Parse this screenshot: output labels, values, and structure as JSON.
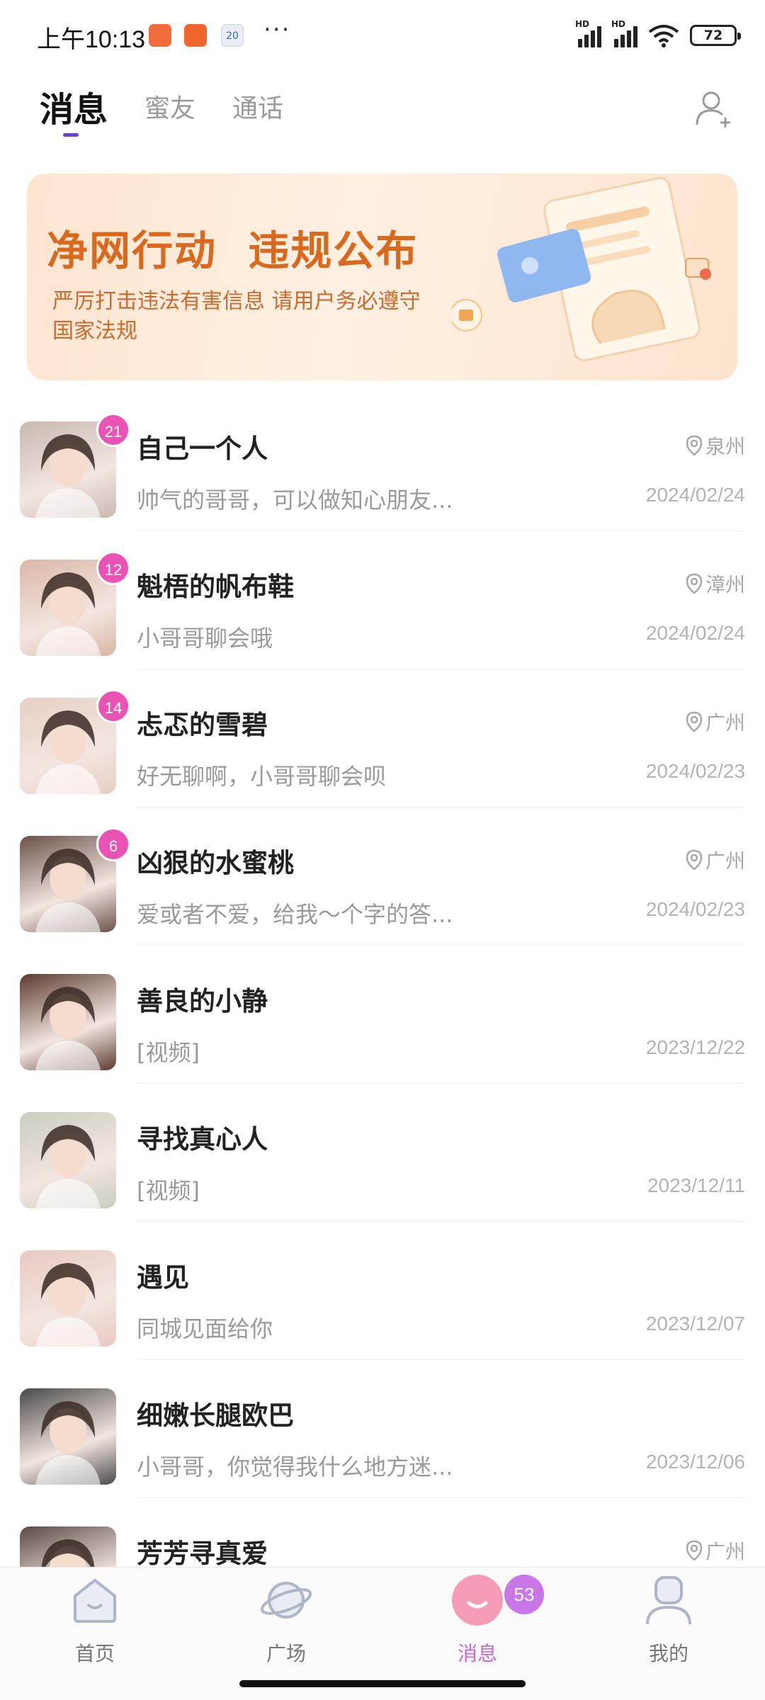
{
  "status_bar": {
    "time": "上午10:13",
    "calendar_day": "20",
    "more": "···",
    "signal1_label": "HD",
    "signal2_label": "HD",
    "battery": "72"
  },
  "tabs": [
    {
      "label": "消息",
      "active": true
    },
    {
      "label": "蜜友",
      "active": false
    },
    {
      "label": "通话",
      "active": false
    }
  ],
  "banner": {
    "title": "净网行动  违规公布",
    "subtitle": "严厉打击违法有害信息  请用户务必遵守国家法规"
  },
  "chats": [
    {
      "name": "自己一个人",
      "message": "帅气的哥哥，可以做知心朋友...",
      "date": "2024/02/24",
      "location": "泉州",
      "unread": "21",
      "avatar_color": "#c8b8b0"
    },
    {
      "name": "魁梧的帆布鞋",
      "message": "小哥哥聊会哦",
      "date": "2024/02/24",
      "location": "漳州",
      "unread": "12",
      "avatar_color": "#d9b7a8"
    },
    {
      "name": "忐忑的雪碧",
      "message": "好无聊啊，小哥哥聊会呗",
      "date": "2024/02/23",
      "location": "广州",
      "unread": "14",
      "avatar_color": "#e6cfc4"
    },
    {
      "name": "凶狠的水蜜桃",
      "message": "爱或者不爱，给我〜个字的答...",
      "date": "2024/02/23",
      "location": "广州",
      "unread": "6",
      "avatar_color": "#6b5149"
    },
    {
      "name": "善良的小静",
      "message": "[视频]",
      "date": "2023/12/22",
      "location": "",
      "unread": "",
      "avatar_color": "#5a3b30"
    },
    {
      "name": "寻找真心人",
      "message": "[视频]",
      "date": "2023/12/11",
      "location": "",
      "unread": "",
      "avatar_color": "#c9cdbf"
    },
    {
      "name": "遇见",
      "message": "同城见面给你",
      "date": "2023/12/07",
      "location": "",
      "unread": "",
      "avatar_color": "#e8c9c2"
    },
    {
      "name": "细嫩长腿欧巴",
      "message": "小哥哥，你觉得我什么地方迷...",
      "date": "2023/12/06",
      "location": "",
      "unread": "",
      "avatar_color": "#4a4a4a"
    },
    {
      "name": "芳芳寻真爱",
      "message": "",
      "date": "",
      "location": "广州",
      "unread": "",
      "avatar_color": "#5b4a46"
    }
  ],
  "bottom_nav": [
    {
      "label": "首页",
      "icon": "home-icon",
      "active": false
    },
    {
      "label": "广场",
      "icon": "planet-icon",
      "active": false
    },
    {
      "label": "消息",
      "icon": "message-icon",
      "active": true,
      "badge": "53"
    },
    {
      "label": "我的",
      "icon": "profile-icon",
      "active": false
    }
  ],
  "colors": {
    "accent": "#6a3fd0",
    "badge": "#e953b3",
    "banner_text": "#d9691f",
    "nav_active": "#c26ad8"
  }
}
